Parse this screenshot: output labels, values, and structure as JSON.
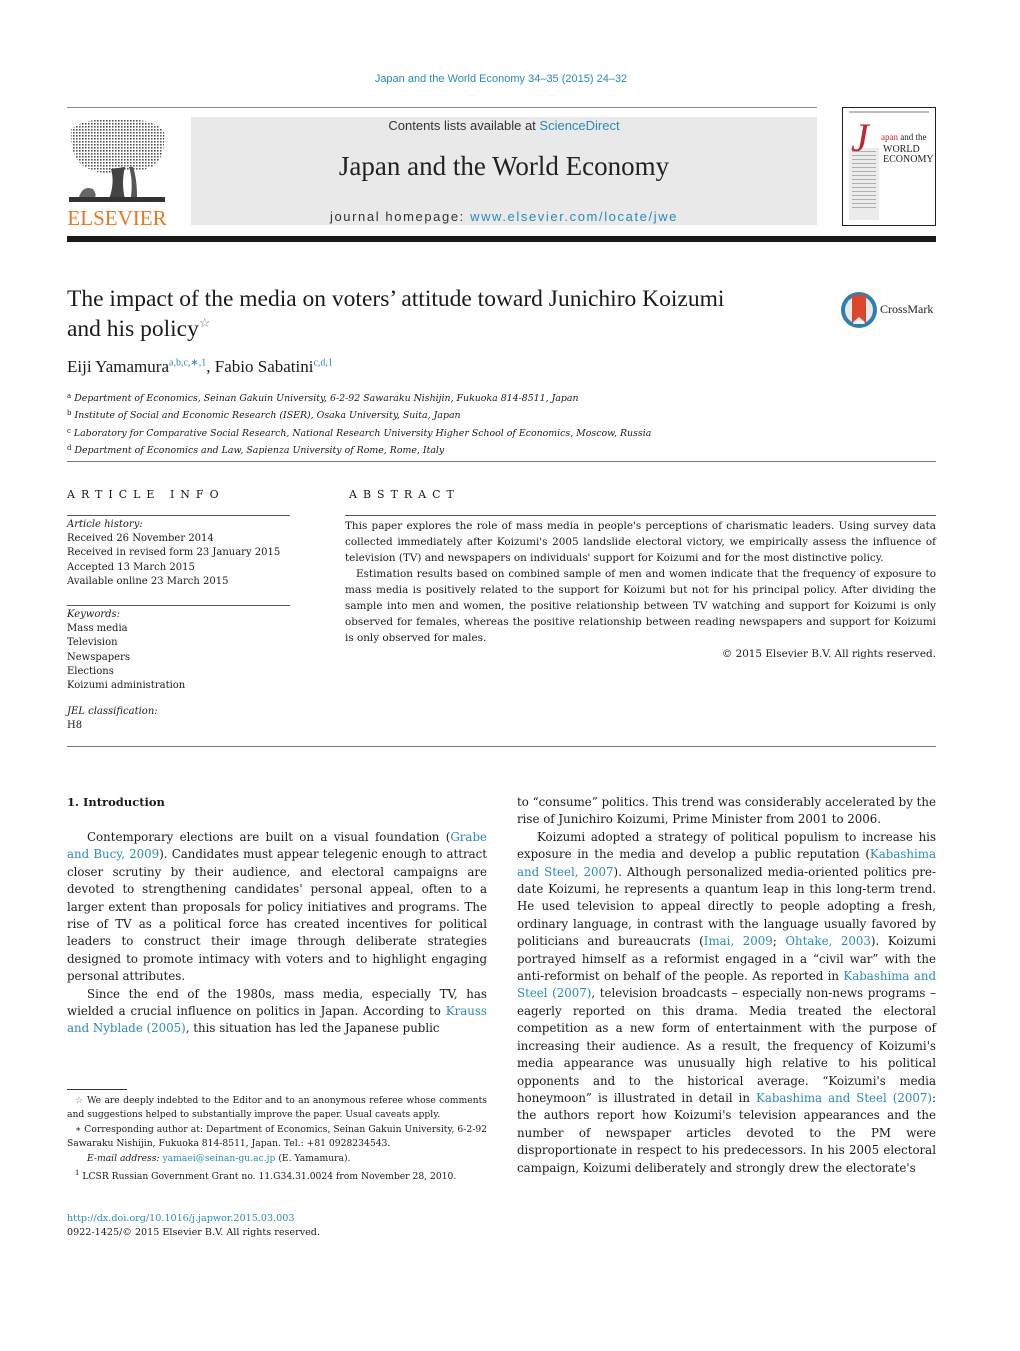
{
  "header": {
    "journal_ref": "Japan and the World Economy 34–35 (2015) 24–32",
    "contents_prefix": "Contents lists available at ",
    "contents_link": "ScienceDirect",
    "journal_name": "Japan and the World Economy",
    "homepage_prefix": "journal homepage: ",
    "homepage_link": "www.elsevier.com/locate/jwe",
    "publisher_logo": "ELSEVIER",
    "cover": {
      "big_letter": "J",
      "line1_red": "apan",
      "line1_rest": " and the",
      "line2": "WORLD",
      "line3": "ECONOMY"
    },
    "crossmark_label": "CrossMark",
    "colors": {
      "link": "#2a8ab8",
      "elsevier_orange": "#e87722",
      "banner_bg": "#e9e9e9"
    }
  },
  "article": {
    "title_line1": "The impact of the media on voters’ attitude toward Junichiro Koizumi",
    "title_line2": "and his policy",
    "title_note": "☆",
    "authors": [
      {
        "name": "Eiji Yamamura",
        "refs": "a,b,c,∗,1"
      },
      {
        "name": "Fabio Sabatini",
        "refs": "c,d,1"
      }
    ],
    "author_sep": ", ",
    "affiliations": [
      {
        "mark": "a",
        "text": "Department of Economics, Seinan Gakuin University, 6-2-92 Sawaraku Nishijin, Fukuoka 814-8511, Japan"
      },
      {
        "mark": "b",
        "text": "Institute of Social and Economic Research (ISER), Osaka University, Suita, Japan"
      },
      {
        "mark": "c",
        "text": "Laboratory for Comparative Social Research, National Research University Higher School of Economics, Moscow, Russia"
      },
      {
        "mark": "d",
        "text": "Department of Economics and Law, Sapienza University of Rome, Rome, Italy"
      }
    ]
  },
  "article_info": {
    "heading": "ARTICLE INFO",
    "history_label": "Article history:",
    "history": [
      "Received 26 November 2014",
      "Received in revised form 23 January 2015",
      "Accepted 13 March 2015",
      "Available online 23 March 2015"
    ],
    "keywords_label": "Keywords:",
    "keywords": [
      "Mass media",
      "Television",
      "Newspapers",
      "Elections",
      "Koizumi administration"
    ],
    "jel_label": "JEL classification:",
    "jel": "H8"
  },
  "abstract": {
    "heading": "ABSTRACT",
    "paragraphs": [
      "This paper explores the role of mass media in people's perceptions of charismatic leaders. Using survey data collected immediately after Koizumi's 2005 landslide electoral victory, we empirically assess the influence of television (TV) and newspapers on individuals' support for Koizumi and for the most distinctive policy.",
      "Estimation results based on combined sample of men and women indicate that the frequency of exposure to mass media is positively related to the support for Koizumi but not for his principal policy. After dividing the sample into men and women, the positive relationship between TV watching and support for Koizumi is only observed for females, whereas the positive relationship between reading newspapers and support for Koizumi is only observed for males."
    ],
    "copyright": "© 2015 Elsevier B.V. All rights reserved."
  },
  "body": {
    "section_heading": "1.  Introduction",
    "left": {
      "p1_a": "Contemporary elections are built on a visual foundation (",
      "p1_link": "Grabe and Bucy, 2009",
      "p1_b": "). Candidates must appear telegenic enough to attract closer scrutiny by their audience, and electoral campaigns are devoted to strengthening candidates' personal appeal, often to a larger extent than proposals for policy initiatives and programs. The rise of TV as a political force has created incentives for political leaders to construct their image through deliberate strategies designed to promote intimacy with voters and to highlight engaging personal attributes.",
      "p2_a": "Since the end of the 1980s, mass media, especially TV, has wielded a crucial influence on politics in Japan. According to ",
      "p2_link": "Krauss and Nyblade (2005)",
      "p2_b": ", this situation has led the Japanese public"
    },
    "right": {
      "p1": "to “consume” politics. This trend was considerably accelerated by the rise of Junichiro Koizumi, Prime Minister from 2001 to 2006.",
      "p2_a": "Koizumi adopted a strategy of political populism to increase his exposure in the media and develop a public reputation (",
      "p2_link1": "Kabashima and Steel, 2007",
      "p2_b": "). Although personalized media-oriented politics pre-date Koizumi, he represents a quantum leap in this long-term trend. He used television to appeal directly to people adopting a fresh, ordinary language, in contrast with the language usually favored by politicians and bureaucrats (",
      "p2_link2": "Imai, 2009",
      "p2_c": "; ",
      "p2_link3": "Ohtake, 2003",
      "p2_d": "). Koizumi portrayed himself as a reformist engaged in a “civil war” with the anti-reformist on behalf of the people. As reported in ",
      "p2_link4": "Kabashima and Steel (2007)",
      "p2_e": ", television broadcasts – especially non-news programs – eagerly reported on this drama. Media treated the electoral competition as a new form of entertainment with the purpose of increasing their audience. As a result, the frequency of Koizumi's media appearance was unusually high relative to his political opponents and to the historical average. “Koizumi's media honeymoon” is illustrated in detail in ",
      "p2_link5": "Kabashima and Steel (2007)",
      "p2_f": ": the authors report how Koizumi's television appearances and the number of newspaper articles devoted to the PM were disproportionate in respect to his predecessors. In his 2005 electoral campaign, Koizumi deliberately and strongly drew the electorate's"
    }
  },
  "footnotes": {
    "star_mark": "☆",
    "star_text": "We are deeply indebted to the Editor and to an anonymous referee whose comments and suggestions helped to substantially improve the paper. Usual caveats apply.",
    "corr_mark": "∗",
    "corr_text": "Corresponding author at: Department of Economics, Seinan Gakuin University, 6-2-92 Sawaraku Nishijin, Fukuoka 814-8511, Japan. Tel.: +81 0928234543.",
    "email_label": "E-mail address: ",
    "email": "yamaei@seinan-gu.ac.jp",
    "email_suffix": " (E. Yamamura).",
    "one_mark": "1",
    "one_text": "LCSR Russian Government Grant no. 11.G34.31.0024 from November 28, 2010."
  },
  "doi": {
    "link": "http://dx.doi.org/10.1016/j.japwor.2015.03.003",
    "issn_line": "0922-1425/© 2015 Elsevier B.V. All rights reserved."
  }
}
